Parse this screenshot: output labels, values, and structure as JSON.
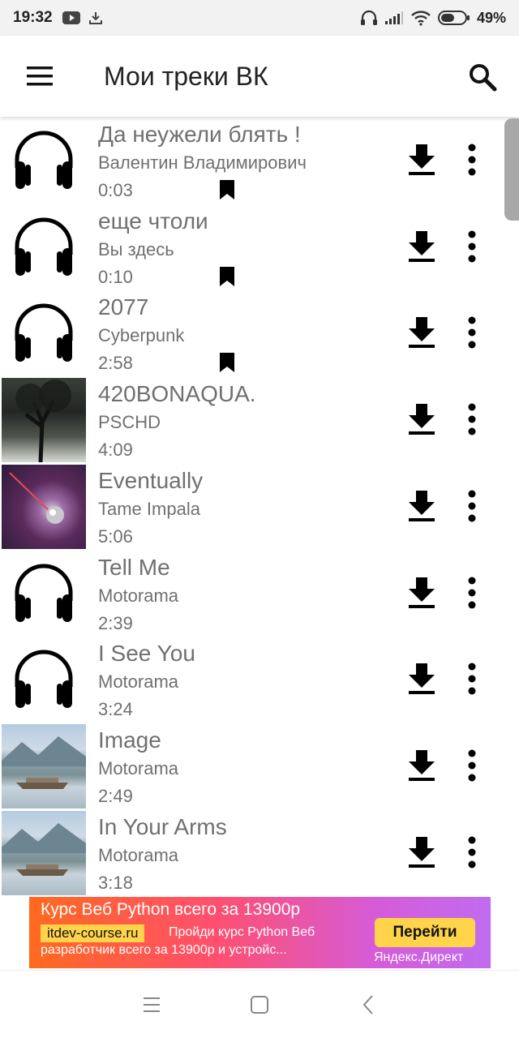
{
  "status_bar": {
    "time": "19:32",
    "battery": "49%",
    "icons": [
      "youtube-icon",
      "download-notification-icon",
      "headphones-icon",
      "signal-icon",
      "wifi-icon",
      "battery-icon"
    ]
  },
  "app_bar": {
    "title": "Мои треки ВК",
    "menu_icon": "hamburger-menu-icon",
    "search_icon": "search-icon"
  },
  "tracks": [
    {
      "title": "Да неужели блять !",
      "artist": "Валентин Владимирович",
      "duration": "0:03",
      "cover": "headphones",
      "bookmarked": true
    },
    {
      "title": "еще чтоли",
      "artist": "Вы здесь",
      "duration": "0:10",
      "cover": "headphones",
      "bookmarked": true
    },
    {
      "title": "2077",
      "artist": "Cyberpunk",
      "duration": "2:58",
      "cover": "headphones",
      "bookmarked": true
    },
    {
      "title": "420BONAQUA.",
      "artist": "PSCHD",
      "duration": "4:09",
      "cover": "album-art-tree",
      "bookmarked": false
    },
    {
      "title": "Eventually",
      "artist": "Tame Impala",
      "duration": "5:06",
      "cover": "album-art-impala",
      "bookmarked": false
    },
    {
      "title": "Tell Me",
      "artist": "Motorama",
      "duration": "2:39",
      "cover": "headphones",
      "bookmarked": false
    },
    {
      "title": "I See You",
      "artist": "Motorama",
      "duration": "3:24",
      "cover": "headphones",
      "bookmarked": false
    },
    {
      "title": "Image",
      "artist": "Motorama",
      "duration": "2:49",
      "cover": "album-art-lake",
      "bookmarked": false
    },
    {
      "title": "In Your Arms",
      "artist": "Motorama",
      "duration": "3:18",
      "cover": "album-art-lake",
      "bookmarked": false
    }
  ],
  "ad": {
    "title": "Курс Веб Python всего за 13900р",
    "site": "itdev-course.ru",
    "desc_line1": "Пройди курс Python Веб",
    "desc_line2": "разработчик всего за 13900р и устройс...",
    "cta": "Перейти",
    "source": "Яндекс.Директ",
    "colors": {
      "start": "#ff6a1e",
      "end": "#c06cf0",
      "accent": "#ffd34a"
    }
  },
  "nav_bar": {
    "icons": [
      "recent-apps-icon",
      "home-icon",
      "back-icon"
    ]
  },
  "colors": {
    "text_secondary": "#707070",
    "icon": "#000000",
    "status_bar_bg": "#f2f2f2"
  }
}
